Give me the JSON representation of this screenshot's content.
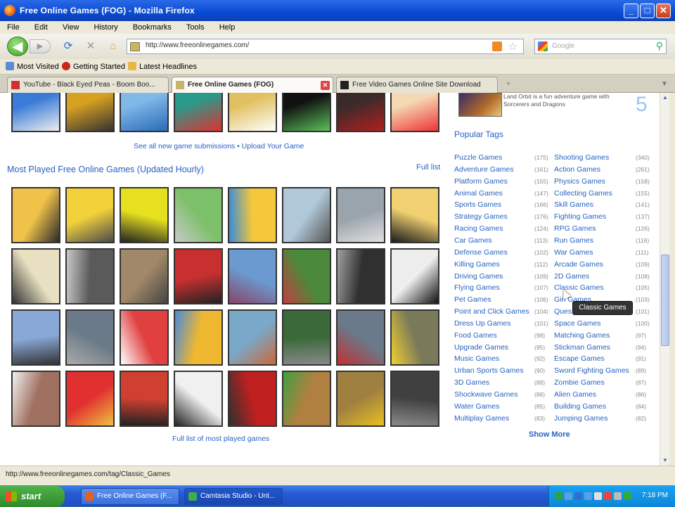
{
  "window": {
    "title": "Free Online Games (FOG) - Mozilla Firefox",
    "controls": [
      "_",
      "□",
      "✕"
    ]
  },
  "menu": [
    "File",
    "Edit",
    "View",
    "History",
    "Bookmarks",
    "Tools",
    "Help"
  ],
  "navigation": {
    "back": "◀",
    "forward": "▶",
    "url": "http://www.freeonlinegames.com/",
    "search_placeholder": "Google"
  },
  "bookmarks": [
    "Most Visited",
    "Getting Started",
    "Latest Headlines"
  ],
  "tabs": [
    {
      "label": "YouTube - Black Eyed Peas - Boom Boo...",
      "active": false
    },
    {
      "label": "Free Online Games (FOG)",
      "active": true
    },
    {
      "label": "Free Video Games Online Site Download",
      "active": false
    }
  ],
  "main": {
    "see_all": "See all new game submissions  •  Upload Your Game",
    "section_title": "Most Played Free Online Games (Updated Hourly)",
    "full_list": "Full list",
    "played_link": "Full list of most played games",
    "grid_rows": 4,
    "grid_cols": 8
  },
  "sidebar": {
    "featured_text": "Land Orbit is a fun adventure game with Sorcerers and Dragons",
    "featured_number": "5",
    "popular_title": "Popular Tags",
    "tags_left": [
      {
        "name": "Puzzle Games",
        "count": "(175)"
      },
      {
        "name": "Adventure Games",
        "count": "(161)"
      },
      {
        "name": "Platform Games",
        "count": "(155)"
      },
      {
        "name": "Animal Games",
        "count": "(147)"
      },
      {
        "name": "Sports Games",
        "count": "(166)"
      },
      {
        "name": "Strategy Games",
        "count": "(176)"
      },
      {
        "name": "Racing Games",
        "count": "(124)"
      },
      {
        "name": "Car Games",
        "count": "(113)"
      },
      {
        "name": "Defense Games",
        "count": "(102)"
      },
      {
        "name": "Killing Games",
        "count": "(112)"
      },
      {
        "name": "Driving Games",
        "count": "(109)"
      },
      {
        "name": "Flying Games",
        "count": "(107)"
      },
      {
        "name": "Pet Games",
        "count": "(106)"
      },
      {
        "name": "Point and Click Games",
        "count": "(104)"
      },
      {
        "name": "Dress Up Games",
        "count": "(101)"
      },
      {
        "name": "Food Games",
        "count": "(98)"
      },
      {
        "name": "Upgrade Games",
        "count": "(95)"
      },
      {
        "name": "Music Games",
        "count": "(92)"
      },
      {
        "name": "Urban Sports Games",
        "count": "(90)"
      },
      {
        "name": "3D Games",
        "count": "(88)"
      },
      {
        "name": "Shockwave Games",
        "count": "(86)"
      },
      {
        "name": "Water Games",
        "count": "(85)"
      },
      {
        "name": "Multiplay Games",
        "count": "(83)"
      }
    ],
    "tags_right": [
      {
        "name": "Shooting Games",
        "count": "(340)"
      },
      {
        "name": "Action Games",
        "count": "(261)"
      },
      {
        "name": "Physics Games",
        "count": "(158)"
      },
      {
        "name": "Collecting Games",
        "count": "(155)"
      },
      {
        "name": "Skill Games",
        "count": "(141)"
      },
      {
        "name": "Fighting Games",
        "count": "(137)"
      },
      {
        "name": "RPG Games",
        "count": "(126)"
      },
      {
        "name": "Run Games",
        "count": "(116)"
      },
      {
        "name": "War Games",
        "count": "(111)"
      },
      {
        "name": "Arcade Games",
        "count": "(109)"
      },
      {
        "name": "2D Games",
        "count": "(108)"
      },
      {
        "name": "Classic Games",
        "count": "(105)"
      },
      {
        "name": "Girl Games",
        "count": "(103)"
      },
      {
        "name": "Quest Games",
        "count": "(101)"
      },
      {
        "name": "Space Games",
        "count": "(100)"
      },
      {
        "name": "Matching Games",
        "count": "(97)"
      },
      {
        "name": "Stickman Games",
        "count": "(94)"
      },
      {
        "name": "Escape Games",
        "count": "(91)"
      },
      {
        "name": "Sword Fighting Games",
        "count": "(89)"
      },
      {
        "name": "Zombie Games",
        "count": "(87)"
      },
      {
        "name": "Alien Games",
        "count": "(86)"
      },
      {
        "name": "Building Games",
        "count": "(84)"
      },
      {
        "name": "Jumping Games",
        "count": "(82)"
      }
    ],
    "show_more": "Show More",
    "tooltip": "Classic Games"
  },
  "status": "http://www.freeonlinegames.com/tag/Classic_Games",
  "taskbar": {
    "start": "start",
    "tasks": [
      "Free Online Games (F...",
      "Camtasia Studio - Unt..."
    ],
    "clock": "7:18 PM"
  },
  "colors": {
    "title_blue": "#0a4bd3",
    "link_blue": "#2861c4",
    "start_green": "#2f8a2b"
  }
}
